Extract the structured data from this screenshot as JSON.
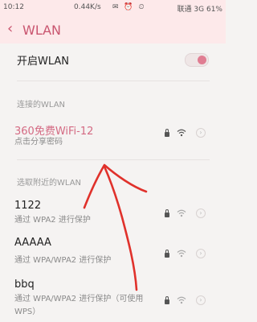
{
  "status_bar": {
    "time": "10:12",
    "speed": "0.44K/s",
    "right": "联通 3G  61%"
  },
  "header": {
    "title": "WLAN"
  },
  "toggle_row": {
    "label": "开启WLAN",
    "state": "on"
  },
  "sections": {
    "connected": "连接的WLAN",
    "nearby": "选取附近的WLAN"
  },
  "connected_network": {
    "name": "360免费WiFi-12",
    "sub": "点击分享密码"
  },
  "networks": [
    {
      "name": "1122",
      "sub": "通过 WPA2 进行保护"
    },
    {
      "name": "AAAAA",
      "sub": "通过 WPA/WPA2 进行保护"
    },
    {
      "name": "bbq",
      "sub": "通过 WPA/WPA2 进行保护（可使用 WPS）"
    }
  ],
  "colors": {
    "accent": "#c9556f",
    "connected": "#d46a83",
    "annotation": "#e0312b"
  }
}
